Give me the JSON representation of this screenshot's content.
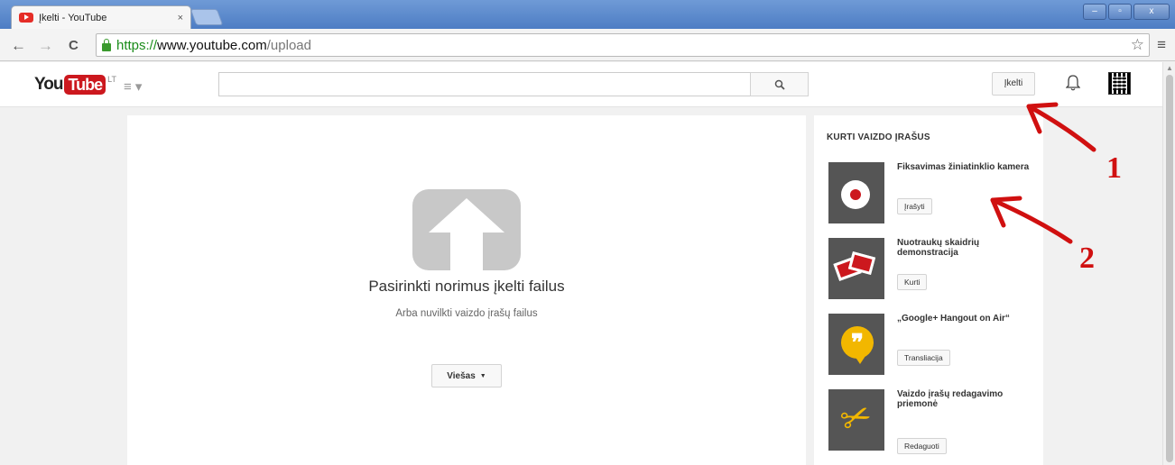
{
  "browser": {
    "tab_title": "Įkelti - YouTube",
    "tab_close": "×",
    "url_protocol": "https://",
    "url_host": "www.youtube.com",
    "url_path": "/upload",
    "back": "←",
    "forward": "→",
    "reload": "C",
    "star": "☆",
    "menu": "≡",
    "window_buttons": [
      "–",
      "▫",
      "x"
    ]
  },
  "header": {
    "logo_you": "You",
    "logo_tube": "Tube",
    "logo_country": "LT",
    "guide_icon": "≡ ▾",
    "search_icon": "🔍",
    "upload_label": "Įkelti",
    "bell_icon": "🔔"
  },
  "main": {
    "title": "Pasirinkti norimus įkelti failus",
    "subtitle": "Arba nuvilkti vaizdo įrašų failus",
    "privacy_label": "Viešas"
  },
  "sidebar": {
    "title": "KURTI VAIZDO ĮRAŠUS",
    "items": [
      {
        "title": "Fiksavimas žiniatinklio kamera",
        "button": "Įrašyti",
        "icon": "webcam-record-icon"
      },
      {
        "title": "Nuotraukų skaidrių demonstracija",
        "button": "Kurti",
        "icon": "photo-slideshow-icon"
      },
      {
        "title": "„Google+ Hangout on Air“",
        "button": "Transliacija",
        "icon": "hangout-icon"
      },
      {
        "title": "Vaizdo įrašų redagavimo priemonė",
        "button": "Redaguoti",
        "icon": "scissors-icon"
      }
    ]
  },
  "annotations": {
    "marker_1": "1",
    "marker_2": "2",
    "color": "#d01010"
  }
}
